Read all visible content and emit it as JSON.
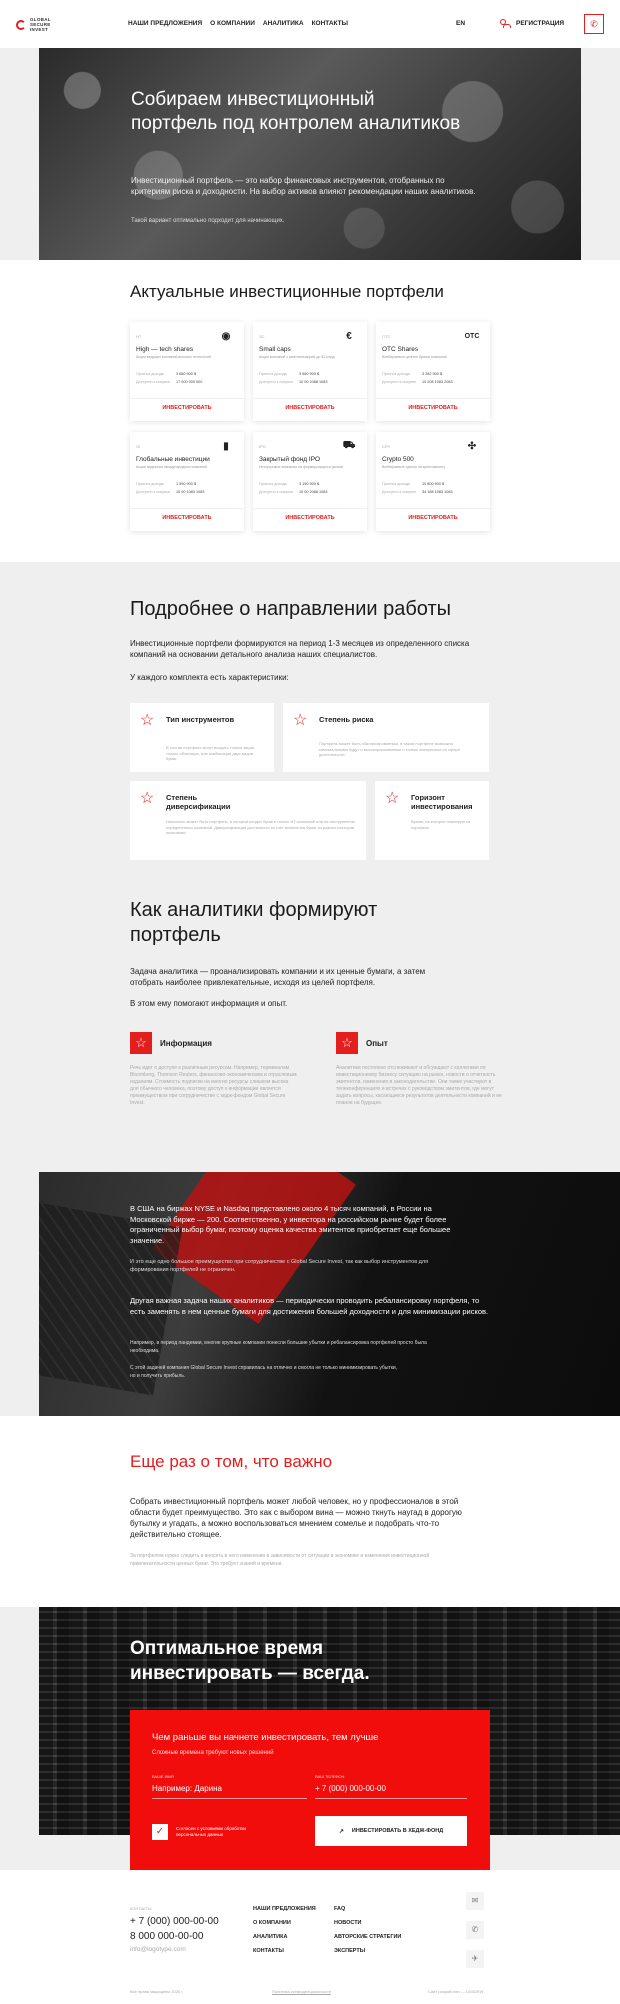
{
  "header": {
    "logo_text": "GLOBAL SECURE INVEST",
    "nav": [
      "НАШИ ПРЕДЛОЖЕНИЯ",
      "О КОМПАНИИ",
      "АНАЛИТИКА",
      "КОНТАКТЫ"
    ],
    "lang": "EN",
    "register": "РЕГИСТРАЦИЯ",
    "phone_button_icon": "phone-icon"
  },
  "hero": {
    "title": "Собираем инвестиционный портфель под контролем аналитиков",
    "text": "Инвестиционный портфель — это набор финансовых инструментов, отобранных по критериям риска и доходности. На выбор активов влияют рекомендации наших аналитиков.",
    "note": "Такой вариант оптимально подходит для начинающих."
  },
  "portfolios": {
    "title": "Актуальные инвестиционные портфели",
    "row_labels": [
      "Прогноз дохода",
      "Доступно к покупке"
    ],
    "cards": [
      {
        "tag": "HT",
        "icon": "◉",
        "name": "High — tech shares",
        "desc": "Акции ведущих компаний высоких технологий",
        "income": "3 680 900 $",
        "amount": "17 000 000 000",
        "button": "ИНВЕСТИРОВАТЬ"
      },
      {
        "tag": "SC",
        "icon": "€",
        "name": "Small caps",
        "desc": "Акции компаний с капитализацией до $1 млрд",
        "income": "3 560 900 $",
        "amount": "10 00 2088 1083",
        "button": "ИНВЕСТИРОВАТЬ"
      },
      {
        "tag": "OTC",
        "icon": "OTC",
        "name": "OTC Shares",
        "desc": "Внебиржевые ценные бумаги компаний",
        "income": "3 282 900 $",
        "amount": "10 208 1083 2083",
        "button": "ИНВЕСТИРОВАТЬ"
      },
      {
        "tag": "GI",
        "icon": "▮",
        "name": "Глобальные инвестиции",
        "desc": "Акции надежных международных компаний",
        "income": "1 590 900 $",
        "amount": "10 00 1083 1083",
        "button": "ИНВЕСТИРОВАТЬ"
      },
      {
        "tag": "IPO",
        "icon": "⛟",
        "name": "Закрытый фонд IPO",
        "desc": "Неторгуемые компании на формирующихся рынках",
        "income": "3 190 900 $",
        "amount": "10 00 2088 1083",
        "button": "ИНВЕСТИРОВАТЬ"
      },
      {
        "tag": "CRY",
        "icon": "✣",
        "name": "Crypto 500",
        "desc": "Внебиржевые сделки на криптовалюту",
        "income": "10 800 900 $",
        "amount": "34 188 1083 1083",
        "button": "ИНВЕСТИРОВАТЬ"
      }
    ]
  },
  "directions": {
    "title": "Подробнее о направлении работы",
    "p1": "Инвестиционные портфели формируются на период 1-3 месяцев из определенного списка компаний на основании детального анализа наших специалистов.",
    "p2": "У каждого комплекта есть характеристики:",
    "features": [
      {
        "title": "Тип инструментов",
        "text": "В состав портфеля могут входить только акции, только облигации, или комбинация двух видов бумаг."
      },
      {
        "title": "Степень риска",
        "text": "Портфель может быть сбалансированным, в таком портфеле возможно минимальными будут и высокорискованные и только интересные по сфере деятельности."
      },
      {
        "title": "Степень диверсификации",
        "text": "Насколько может быть портфель, в который входят бумаги только ИТ-компаний или на инструментах определенных компаний. Диверсификация достигается за счет включения бумаг из разных секторов экономики."
      },
      {
        "title": "Горизонт инвестирования",
        "text": "Время, на которое планируется портфель."
      }
    ]
  },
  "analysts": {
    "title": "Как аналитики формируют портфель",
    "p1": "Задача аналитика — проанализировать компании и их ценные бумаги, а затем отобрать наиболее привлекательные, исходя из целей портфеля.",
    "p2": "В этом ему помогают информация и опыт.",
    "info": {
      "title": "Информация",
      "text": "Речь идет о доступе к различным ресурсам. Например, терминалам Bloomberg, Thomson Reuters, финансово-экономическим и отраслевым изданиям. Стоимость подписки на многие ресурсы слишком высока для обычного человека, поэтому доступ к информации является преимуществом при сотрудничестве с хедж-фондом Global Secure Invest."
    },
    "exp": {
      "title": "Опыт",
      "text": "Аналитики постоянно отслеживают и обсуждают с коллегами по инвестиционному бизнесу ситуацию на рынке, новости о отчетность эмитентов, изменения в законодательстве. Они также участвуют в телеконференциях и встречах с руководством эмитентов, где могут задать вопросы, касающиеся результатов деятельности компаний и ее планов на будущее."
    }
  },
  "dark": {
    "p1": "В США на биржах NYSE и Nasdaq представлено около 4 тысяч компаний, в России на Московской бирже — 200. Соответственно, у инвестора на российском рынке будет более ограниченный выбор бумаг, поэтому оценка качества эмитентов приобретает еще большее значение.",
    "p2": "И это еще одно большое преимущество при сотрудничестве с Global Secure Invest, так как выбор инструментов для формирования портфелей не ограничен.",
    "p3": "Другая важная задача наших аналитиков — периодически проводить ребалансировку портфеля, то есть заменять в нем ценные бумаги для достижения большей доходности и для минимизации рисков.",
    "p4": "Например, в период пандемии, многие крупные компании понесли большие убытки и ребалансировка портфелей просто была необходима.",
    "p5": "С этой задачей компания Global Secure Invest справилась на отлично и смогла не только минимизировать убытки, но и получить прибыль."
  },
  "important": {
    "title": "Еще раз о том, что важно",
    "p1": "Собрать инвестиционный портфель может любой человек, но у профессионалов в этой области будет преимущество. Это как с выбором вина — можно ткнуть наугад в дорогую бутылку и угадать, а можно воспользоваться мнением сомелье и подобрать что-то действительно стоящее.",
    "p2": "За портфелем нужно следить и вносить в него изменения в зависимости от ситуации в экономике и изменения инвестиционной привлекательности ценных бумаг. Это требует знаний и времени."
  },
  "cta": {
    "title": "Оптимальное время инвестировать — всегда.",
    "box_title": "Чем раньше вы начнете инвестировать, тем лучше",
    "box_sub": "Сложные времена требуют новых решений",
    "name_label": "ВАШЕ ИМЯ",
    "name_placeholder": "Например: Дарина",
    "phone_label": "ВАШ ТЕЛЕФОН",
    "phone_placeholder": "+ 7 (000) 000-00-00",
    "consent": "Согласен с условиями обработки персональных данных",
    "button": "ИНВЕСТИРОВАТЬ В ХЕДЖ-ФОНД"
  },
  "footer": {
    "contacts_label": "КОНТАКТЫ",
    "phone1": "+ 7 (000) 000-00-00",
    "phone2": "8 000 000-00-00",
    "email": "info@logotype.com",
    "col1": [
      "НАШИ ПРЕДЛОЖЕНИЯ",
      "О КОМПАНИИ",
      "АНАЛИТИКА",
      "КОНТАКТЫ"
    ],
    "col2": [
      "FAQ",
      "НОВОСТИ",
      "АВТОРСКИЕ СТРАТЕГИИ",
      "ЭКСПЕРТЫ"
    ],
    "copyright": "Все права защищены 2020 г.",
    "policy": "Политика конфиденциальности",
    "dev": "Сайт разработан — DIGIDEW"
  },
  "colors": {
    "accent": "#e41d1d",
    "cta_red": "#f20d0d"
  }
}
